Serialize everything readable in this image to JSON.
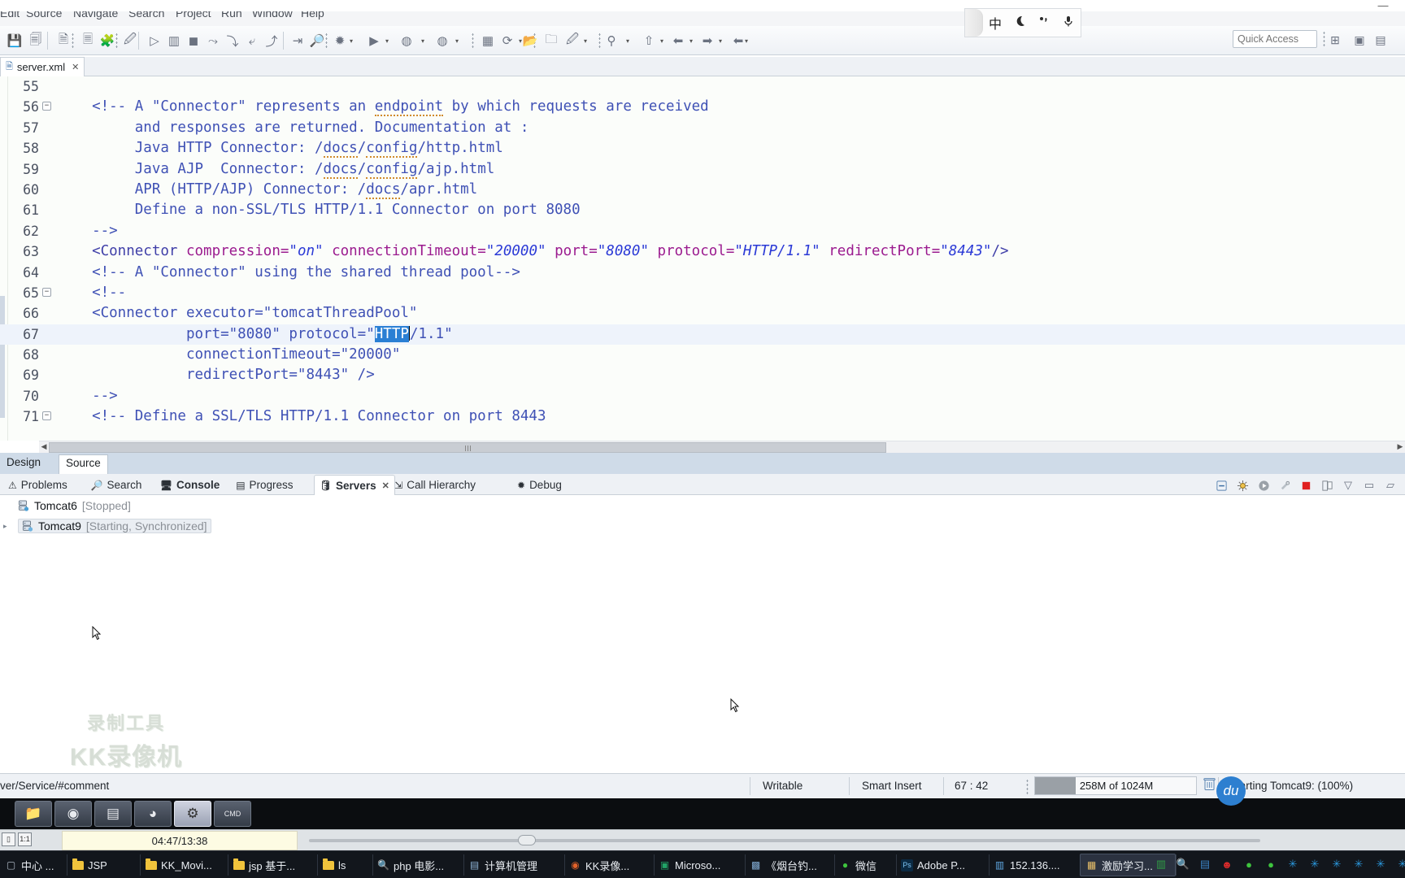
{
  "window": {
    "minimize_label": "—"
  },
  "menubar": {
    "items": [
      "Edit",
      "Source",
      "Navigate",
      "Search",
      "Project",
      "Run",
      "Window",
      "Help"
    ]
  },
  "toolbar": {
    "quick_access_placeholder": "Quick Access",
    "quick_access_value": "Quick Access",
    "icons": [
      "save-icon",
      "save-all-icon",
      "new-xml-icon",
      "toggle-mark-occurrences-icon",
      "open-type-icon",
      "skip-breakpoints-icon",
      "step-over-icon",
      "layout-icon",
      "terminate-icon",
      "next-annotation-icon",
      "step-into-icon",
      "step-return-icon",
      "resume-icon",
      "forward-icon",
      "debug-icon",
      "run-icon",
      "run-as-icon",
      "coverage-icon",
      "new-wizard-icon",
      "refresh-icon",
      "open-folder-icon",
      "open-box-icon",
      "edit-icon",
      "search-icon",
      "person-icon",
      "back-icon",
      "forward-nav-icon"
    ]
  },
  "ime": {
    "icons": [
      "chinese-mode-icon",
      "moon-icon",
      "punctuation-icon",
      "microphone-icon"
    ],
    "labels": [
      "中",
      "☾",
      "°,",
      "🎤"
    ]
  },
  "editor": {
    "tab": {
      "title": "server.xml",
      "icon": "xml-file-icon",
      "close_label": "✕"
    },
    "design_source_tabs": [
      {
        "label": "Design",
        "active": false
      },
      {
        "label": "Source",
        "active": true
      }
    ],
    "first_visible_line": 55,
    "lines": [
      {
        "no": 55,
        "fold": false,
        "indent": 0,
        "tokens": []
      },
      {
        "no": 56,
        "fold": true,
        "indent": 0,
        "tokens": [
          {
            "t": "comment",
            "v": "  <!-- A \"Connector\" represents an "
          },
          {
            "t": "comment-spell",
            "v": "endpoint"
          },
          {
            "t": "comment",
            "v": " by which requests are received"
          }
        ]
      },
      {
        "no": 57,
        "fold": false,
        "indent": 0,
        "tokens": [
          {
            "t": "comment",
            "v": "       and responses are returned. Documentation at :"
          }
        ]
      },
      {
        "no": 58,
        "fold": false,
        "indent": 0,
        "tokens": [
          {
            "t": "comment",
            "v": "       Java HTTP Connector: /"
          },
          {
            "t": "comment-spell",
            "v": "docs"
          },
          {
            "t": "comment",
            "v": "/"
          },
          {
            "t": "comment-spell",
            "v": "config"
          },
          {
            "t": "comment",
            "v": "/http.html"
          }
        ]
      },
      {
        "no": 59,
        "fold": false,
        "indent": 0,
        "tokens": [
          {
            "t": "comment",
            "v": "       Java AJP  Connector: /"
          },
          {
            "t": "comment-spell",
            "v": "docs"
          },
          {
            "t": "comment",
            "v": "/"
          },
          {
            "t": "comment-spell",
            "v": "config"
          },
          {
            "t": "comment",
            "v": "/ajp.html"
          }
        ]
      },
      {
        "no": 60,
        "fold": false,
        "indent": 0,
        "tokens": [
          {
            "t": "comment",
            "v": "       APR (HTTP/AJP) Connector: /"
          },
          {
            "t": "comment-spell",
            "v": "docs"
          },
          {
            "t": "comment",
            "v": "/apr.html"
          }
        ]
      },
      {
        "no": 61,
        "fold": false,
        "indent": 0,
        "tokens": [
          {
            "t": "comment",
            "v": "       Define a non-SSL/TLS HTTP/1.1 Connector on port 8080"
          }
        ]
      },
      {
        "no": 62,
        "fold": false,
        "indent": 0,
        "tokens": [
          {
            "t": "comment",
            "v": "  -->"
          }
        ]
      },
      {
        "no": 63,
        "fold": false,
        "indent": 0,
        "tokens": [
          {
            "t": "tag",
            "v": "  <Connector "
          },
          {
            "t": "attr",
            "v": "compression="
          },
          {
            "t": "val",
            "v": "\"on\""
          },
          {
            "t": "plain",
            "v": " "
          },
          {
            "t": "attr",
            "v": "connectionTimeout="
          },
          {
            "t": "val",
            "v": "\"20000\""
          },
          {
            "t": "plain",
            "v": " "
          },
          {
            "t": "attr",
            "v": "port="
          },
          {
            "t": "val",
            "v": "\"8080\""
          },
          {
            "t": "plain",
            "v": " "
          },
          {
            "t": "attr",
            "v": "protocol="
          },
          {
            "t": "val",
            "v": "\"HTTP/1.1\""
          },
          {
            "t": "plain",
            "v": " "
          },
          {
            "t": "attr",
            "v": "redirectPort="
          },
          {
            "t": "val",
            "v": "\"8443\""
          },
          {
            "t": "tag",
            "v": "/>"
          }
        ]
      },
      {
        "no": 64,
        "fold": false,
        "indent": 0,
        "tokens": [
          {
            "t": "comment",
            "v": "  <!-- A \"Connector\" using the shared thread pool-->"
          }
        ]
      },
      {
        "no": 65,
        "fold": true,
        "indent": 0,
        "tokens": [
          {
            "t": "comment",
            "v": "  <!--"
          }
        ]
      },
      {
        "no": 66,
        "fold": false,
        "indent": 0,
        "tokens": [
          {
            "t": "comment",
            "v": "  <Connector executor=\"tomcatThreadPool\""
          }
        ]
      },
      {
        "no": 67,
        "fold": false,
        "indent": 0,
        "highlight": true,
        "tokens": [
          {
            "t": "comment",
            "v": "             port=\"8080\" protocol=\""
          },
          {
            "t": "selected",
            "v": "HTTP"
          },
          {
            "t": "caret",
            "v": ""
          },
          {
            "t": "comment",
            "v": "/1.1\""
          }
        ]
      },
      {
        "no": 68,
        "fold": false,
        "indent": 0,
        "tokens": [
          {
            "t": "comment",
            "v": "             connectionTimeout=\"20000\""
          }
        ]
      },
      {
        "no": 69,
        "fold": false,
        "indent": 0,
        "tokens": [
          {
            "t": "comment",
            "v": "             redirectPort=\"8443\" />"
          }
        ]
      },
      {
        "no": 70,
        "fold": false,
        "indent": 0,
        "tokens": [
          {
            "t": "comment",
            "v": "  -->"
          }
        ]
      },
      {
        "no": 71,
        "fold": true,
        "indent": 0,
        "tokens": [
          {
            "t": "comment",
            "v": "  <!-- Define a SSL/TLS HTTP/1.1 Connector on port 8443"
          }
        ]
      }
    ]
  },
  "bottom_views": {
    "tabs": [
      {
        "label": "Problems",
        "icon": "problems-icon",
        "active": false,
        "bold": false
      },
      {
        "label": "Search",
        "icon": "search-icon",
        "active": false,
        "bold": false
      },
      {
        "label": "Console",
        "icon": "console-icon",
        "active": false,
        "bold": true
      },
      {
        "label": "Progress",
        "icon": "progress-icon",
        "active": false,
        "bold": false
      },
      {
        "label": "Servers",
        "icon": "servers-icon",
        "active": true,
        "bold": true,
        "close": "✕"
      },
      {
        "label": "Call Hierarchy",
        "icon": "call-hierarchy-icon",
        "active": false,
        "bold": false
      },
      {
        "label": "Debug",
        "icon": "debug-icon",
        "active": false,
        "bold": false
      }
    ],
    "toolbar_icons": [
      "collapse-all-icon",
      "debug-server-icon",
      "start-server-icon",
      "profile-server-icon",
      "stop-server-icon",
      "publish-icon",
      "view-menu-icon",
      "minimize-icon",
      "maximize-icon"
    ]
  },
  "servers": {
    "rows": [
      {
        "name": "Tomcat6",
        "state": "[Stopped]",
        "icon": "server-stopped-icon",
        "expandable": false,
        "selected": false
      },
      {
        "name": "Tomcat9",
        "state": "[Starting, Synchronized]",
        "icon": "server-starting-icon",
        "expandable": true,
        "selected": true
      }
    ]
  },
  "watermark": {
    "line1": "录制工具",
    "line2": "KK录像机"
  },
  "statusbar": {
    "path": "ver/Service/#comment",
    "writable": "Writable",
    "insert_mode": "Smart Insert",
    "position": "67 : 42",
    "heap_label": "258M of 1024M",
    "heap_percent": 25,
    "trash_icon": "trash-icon",
    "task": "Starting Tomcat9: (100%)"
  },
  "launchbar": {
    "buttons": [
      {
        "icon": "file-explorer-icon",
        "glyph": "📁",
        "active": false
      },
      {
        "icon": "chrome-icon",
        "glyph": "◉",
        "active": false
      },
      {
        "icon": "media-player-icon",
        "glyph": "▤",
        "active": false
      },
      {
        "icon": "ie-browser-icon",
        "glyph": "◕",
        "active": false
      },
      {
        "icon": "settings-gear-icon",
        "glyph": "⚙",
        "active": true
      },
      {
        "icon": "command-prompt-icon",
        "glyph": "CMD",
        "active": false
      }
    ]
  },
  "player_band": {
    "time": "04:47/13:38",
    "left_icons": [
      "stop-icon",
      "scale-1-1-icon"
    ],
    "seek_percent": 22
  },
  "taskbar": {
    "buttons": [
      {
        "label": "中心 ...",
        "icon": "window-icon",
        "current": false
      },
      {
        "label": "JSP",
        "icon": "folder-icon",
        "current": false
      },
      {
        "label": "KK_Movi...",
        "icon": "folder-icon",
        "current": false
      },
      {
        "label": "jsp 基于...",
        "icon": "folder-icon",
        "current": false
      },
      {
        "label": "ls",
        "icon": "folder-icon",
        "current": false
      },
      {
        "label": "php 电影...",
        "icon": "search-icon",
        "current": false
      },
      {
        "label": "计算机管理",
        "icon": "computer-management-icon",
        "current": false
      },
      {
        "label": "KK录像...",
        "icon": "kk-recorder-icon",
        "current": false
      },
      {
        "label": "Microso...",
        "icon": "excel-icon",
        "current": false
      },
      {
        "label": "《烟台钓...",
        "icon": "image-icon",
        "current": false
      },
      {
        "label": "微信",
        "icon": "wechat-icon",
        "current": false
      },
      {
        "label": "Adobe P...",
        "icon": "photoshop-icon",
        "current": false
      },
      {
        "label": "152.136....",
        "icon": "remote-desktop-icon",
        "current": false
      },
      {
        "label": "激励学习...",
        "icon": "document-icon",
        "current": true
      }
    ],
    "tray_icons": [
      "chart-icon",
      "search-icon",
      "media-icon",
      "face-icon",
      "wechat-icon",
      "wechat-2-icon",
      "star-1-icon",
      "star-2-icon",
      "star-3-icon",
      "star-4-icon",
      "star-5-icon",
      "star-6-icon",
      "star-7-icon",
      "shield-icon",
      "tim-1-icon",
      "tim-2-icon",
      "update-icon",
      "sound-icon",
      "nvidia-icon",
      "network-icon"
    ],
    "baidu_icon": "baidu-icon",
    "baidu_label": "du"
  }
}
